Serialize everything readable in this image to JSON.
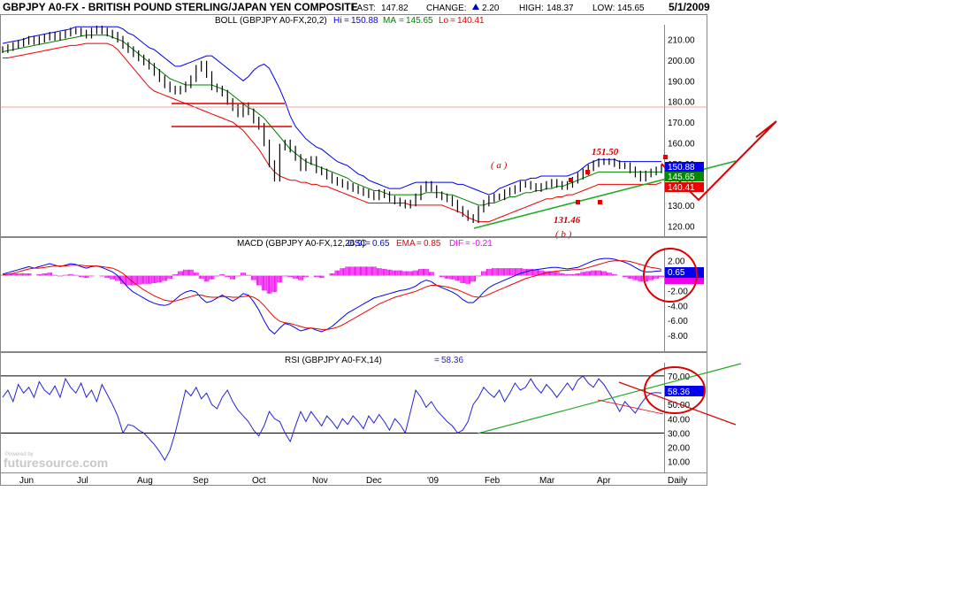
{
  "header": {
    "title": "GBPJPY A0-FX - BRITISH POUND STERLING/JAPAN YEN COMPOSITE",
    "last_label": "LAST:",
    "last": "147.82",
    "change_label": "CHANGE:",
    "change": "2.20",
    "high_label": "HIGH:",
    "high": "148.37",
    "low_label": "LOW:",
    "low": "145.65",
    "date": "5/1/2009"
  },
  "watermark": {
    "small": "Powered by",
    "brand": "futuresource.com"
  },
  "colors": {
    "price": "#000000",
    "upper_band": "#0000ee",
    "middle_band": "#008000",
    "lower_band": "#ee0000",
    "macd_line": "#0000ee",
    "signal_line": "#ee0000",
    "histogram": "#ee00ee",
    "rsi_line": "#2222dd",
    "annotation": "#cc0000",
    "trend_green": "#22aa22"
  },
  "chart_data": [
    {
      "type": "line",
      "name": "price-panel",
      "legend": {
        "study": "BOLL (GBPJPY A0-FX,20,2)",
        "hi_label": "Hi",
        "hi": "150.88",
        "ma_label": "MA",
        "ma": "145.65",
        "lo_label": "Lo",
        "lo": "140.41"
      },
      "ylim": [
        115,
        217
      ],
      "yticks": [
        "210.00",
        "200.00",
        "190.00",
        "180.00",
        "170.00",
        "160.00",
        "150.00",
        "140.00",
        "130.00",
        "120.00"
      ],
      "series": [
        {
          "name": "price",
          "values": [
            205,
            206,
            207,
            208,
            209,
            210,
            209,
            210,
            211,
            212,
            211,
            212,
            213,
            214,
            214,
            213,
            212,
            214,
            215,
            214,
            213,
            212,
            210,
            207,
            205,
            203,
            201,
            199,
            197,
            194,
            191,
            188,
            186,
            185,
            186,
            188,
            191,
            196,
            198,
            193,
            187,
            186,
            184,
            180,
            177,
            174,
            178,
            175,
            171,
            168,
            160,
            150,
            143,
            158,
            160,
            157,
            153,
            148,
            151,
            152,
            147,
            146,
            144,
            142,
            141,
            140,
            139,
            138,
            137,
            136,
            135,
            134,
            136,
            135,
            133,
            132,
            131,
            130,
            131,
            134,
            138,
            140,
            138,
            135,
            134,
            133,
            131,
            128,
            126,
            124,
            123,
            128,
            131,
            133,
            134,
            134,
            136,
            137,
            138,
            140,
            140,
            139,
            138,
            139,
            140,
            141,
            140,
            139,
            140,
            142,
            144,
            146,
            148,
            150,
            151,
            151,
            151,
            150,
            149,
            149,
            147,
            145,
            143,
            145,
            146,
            147,
            148
          ]
        },
        {
          "name": "upper_band",
          "values": [
            208,
            208.5,
            209,
            209.5,
            210,
            211,
            211.5,
            212,
            212.5,
            213,
            213.5,
            214,
            214.5,
            215,
            216,
            216,
            216,
            216,
            216,
            216,
            216,
            216,
            216,
            215,
            213,
            212,
            210,
            208,
            206,
            205,
            203,
            201,
            199,
            197,
            197,
            198,
            199,
            200,
            201,
            202,
            202,
            200,
            198,
            196,
            194,
            192,
            190,
            192,
            195,
            197,
            198,
            196,
            191,
            186,
            180,
            173,
            168,
            165,
            162,
            160,
            158,
            157,
            155,
            153,
            151,
            150,
            149,
            147,
            145,
            144,
            142,
            141,
            140,
            139,
            138,
            138,
            138,
            139,
            140,
            141,
            141,
            141,
            141,
            141,
            141,
            141,
            141,
            140,
            140,
            139,
            138,
            137,
            136,
            135,
            136,
            138,
            139,
            140,
            141,
            142,
            142,
            143,
            143,
            144,
            144,
            144,
            144,
            144,
            144,
            145,
            146,
            148,
            150,
            151,
            152,
            152,
            152,
            152,
            151,
            151,
            151,
            151,
            151,
            151,
            151,
            151,
            151
          ]
        },
        {
          "name": "middle_band",
          "values": [
            204,
            204.5,
            205,
            205.5,
            206,
            206.5,
            207,
            207.5,
            208,
            208.5,
            209,
            209.5,
            210,
            210.5,
            211,
            211.5,
            212,
            212,
            212,
            212,
            212,
            211,
            210,
            209,
            207,
            205,
            203,
            201,
            199,
            197,
            195,
            193,
            191,
            190,
            189,
            188,
            188,
            188,
            188,
            188,
            188,
            187,
            186,
            185,
            183,
            181,
            179,
            177,
            176,
            174,
            172,
            169,
            166,
            163,
            160,
            157,
            155,
            153,
            151,
            150,
            149,
            148,
            147,
            146,
            145,
            144,
            143,
            141,
            140,
            139,
            138,
            137,
            137,
            136,
            135,
            135,
            135,
            135,
            135,
            135,
            135,
            136,
            136,
            136,
            136,
            135,
            135,
            134,
            133,
            132,
            131,
            130,
            130,
            131,
            131,
            132,
            133,
            134,
            134,
            135,
            136,
            136,
            137,
            137,
            138,
            138,
            139,
            139,
            140,
            141,
            142,
            143,
            144,
            145,
            146,
            146,
            146,
            146,
            146,
            146,
            146,
            146,
            146,
            146,
            146,
            146,
            146
          ]
        },
        {
          "name": "lower_band",
          "values": [
            201,
            201,
            201.5,
            202,
            202.5,
            203,
            203.5,
            204,
            204.5,
            205,
            205.5,
            206,
            206.5,
            207,
            207,
            207.5,
            208,
            208,
            208,
            208,
            208,
            207,
            205,
            202,
            199,
            196,
            193,
            190,
            187,
            185,
            184,
            183,
            182,
            181,
            180,
            179,
            178,
            177,
            176,
            175,
            174,
            173,
            172,
            171,
            170,
            168,
            166,
            163,
            160,
            157,
            153,
            149,
            146,
            144,
            143,
            142,
            142,
            141,
            141,
            140,
            140,
            139,
            139,
            138,
            137,
            136,
            135,
            134,
            133,
            132,
            131,
            131,
            131,
            131,
            131,
            131,
            131,
            131,
            130,
            130,
            130,
            130,
            130,
            130,
            130,
            129,
            128,
            127,
            126,
            124,
            123,
            122,
            122,
            122,
            123,
            124,
            125,
            126,
            127,
            128,
            129,
            130,
            131,
            132,
            133,
            133,
            134,
            134,
            135,
            135,
            136,
            137,
            138,
            139,
            140,
            140,
            140,
            140,
            140,
            140,
            140,
            140,
            140,
            140,
            140,
            140,
            141
          ]
        }
      ],
      "annotations": [
        {
          "text": "( a )"
        },
        {
          "text": "151.50"
        },
        {
          "text": "131.46"
        },
        {
          "text": "( b )"
        }
      ],
      "last_labels": [
        "150.88",
        "145.65",
        "140.41"
      ]
    },
    {
      "type": "bar",
      "name": "macd-panel",
      "legend": {
        "study": "MACD (GBPJPY A0-FX,12,26,9)",
        "osc_label": "OSC",
        "osc": "0.65",
        "ema_label": "EMA",
        "ema": "0.85",
        "dif_label": "DIF",
        "dif": "-0.21"
      },
      "ylim": [
        -10,
        3.5
      ],
      "yticks": [
        "2.00",
        "0.00",
        "-2.00",
        "-4.00",
        "-6.00",
        "-8.00"
      ],
      "series": [
        {
          "name": "macd",
          "values": [
            0.2,
            0.4,
            0.6,
            0.8,
            1.0,
            1.2,
            1.0,
            1.2,
            1.4,
            1.6,
            1.4,
            1.2,
            1.4,
            1.6,
            1.5,
            1.2,
            1.0,
            1.2,
            1.3,
            1.1,
            0.8,
            0.5,
            0.0,
            -0.8,
            -1.6,
            -2.2,
            -2.6,
            -3.0,
            -3.4,
            -3.7,
            -3.9,
            -4.0,
            -3.8,
            -3.2,
            -2.6,
            -2.2,
            -2.0,
            -2.2,
            -3.0,
            -3.6,
            -3.4,
            -3.0,
            -2.6,
            -3.0,
            -3.4,
            -3.0,
            -2.4,
            -2.6,
            -3.5,
            -4.6,
            -6.0,
            -7.2,
            -7.8,
            -7.0,
            -6.4,
            -6.6,
            -7.0,
            -7.4,
            -7.2,
            -7.0,
            -7.3,
            -7.5,
            -7.2,
            -6.8,
            -6.2,
            -5.6,
            -5.0,
            -4.6,
            -4.2,
            -3.8,
            -3.4,
            -3.0,
            -2.8,
            -2.6,
            -2.4,
            -2.2,
            -2.0,
            -1.9,
            -1.7,
            -1.4,
            -0.9,
            -0.6,
            -0.8,
            -1.3,
            -1.6,
            -1.9,
            -2.2,
            -2.6,
            -3.2,
            -3.6,
            -3.6,
            -3.0,
            -2.2,
            -1.6,
            -1.2,
            -0.9,
            -0.6,
            -0.3,
            0.0,
            0.3,
            0.5,
            0.7,
            0.8,
            0.9,
            1.0,
            1.1,
            1.1,
            1.0,
            0.9,
            1.0,
            1.1,
            1.4,
            1.7,
            2.0,
            2.2,
            2.3,
            2.3,
            2.2,
            2.0,
            1.8,
            1.5,
            1.1,
            0.7,
            0.5,
            0.5,
            0.6,
            0.65
          ]
        },
        {
          "name": "signal",
          "values": [
            0.1,
            0.2,
            0.3,
            0.5,
            0.7,
            0.9,
            1.0,
            1.0,
            1.1,
            1.2,
            1.3,
            1.3,
            1.3,
            1.4,
            1.4,
            1.4,
            1.3,
            1.3,
            1.3,
            1.2,
            1.1,
            1.0,
            0.7,
            0.3,
            -0.3,
            -0.9,
            -1.4,
            -1.9,
            -2.3,
            -2.7,
            -3.0,
            -3.3,
            -3.4,
            -3.4,
            -3.2,
            -3.0,
            -2.8,
            -2.6,
            -2.6,
            -2.8,
            -2.9,
            -2.9,
            -2.8,
            -2.8,
            -2.9,
            -2.9,
            -2.8,
            -2.7,
            -2.9,
            -3.3,
            -4.0,
            -4.8,
            -5.6,
            -6.1,
            -6.3,
            -6.4,
            -6.6,
            -6.8,
            -7.0,
            -7.0,
            -7.1,
            -7.2,
            -7.2,
            -7.1,
            -6.9,
            -6.6,
            -6.2,
            -5.8,
            -5.4,
            -5.0,
            -4.6,
            -4.2,
            -3.8,
            -3.5,
            -3.2,
            -2.9,
            -2.7,
            -2.5,
            -2.3,
            -2.1,
            -1.8,
            -1.5,
            -1.3,
            -1.3,
            -1.4,
            -1.5,
            -1.7,
            -1.9,
            -2.2,
            -2.5,
            -2.8,
            -2.9,
            -2.8,
            -2.5,
            -2.2,
            -1.9,
            -1.6,
            -1.3,
            -1.0,
            -0.7,
            -0.4,
            -0.2,
            0.0,
            0.2,
            0.4,
            0.5,
            0.6,
            0.7,
            0.7,
            0.8,
            0.8,
            0.9,
            1.1,
            1.3,
            1.5,
            1.7,
            1.9,
            2.0,
            2.0,
            2.0,
            1.9,
            1.7,
            1.5,
            1.3,
            1.1,
            1.0,
            0.85
          ]
        }
      ],
      "last_labels": [
        "0.65",
        "0.85"
      ]
    },
    {
      "type": "line",
      "name": "rsi-panel",
      "legend": {
        "study": "RSI (GBPJPY A0-FX,14)",
        "value": "58.36"
      },
      "ylim": [
        3,
        78
      ],
      "yticks": [
        "70.00",
        "60.00",
        "50.00",
        "40.00",
        "30.00",
        "20.00",
        "10.00"
      ],
      "hlines": [
        70,
        30
      ],
      "series": [
        {
          "name": "rsi",
          "values": [
            55,
            60,
            52,
            64,
            58,
            62,
            55,
            66,
            60,
            57,
            63,
            55,
            68,
            62,
            58,
            65,
            55,
            60,
            52,
            64,
            57,
            50,
            42,
            30,
            36,
            35,
            32,
            30,
            26,
            22,
            17,
            11,
            18,
            30,
            45,
            60,
            56,
            62,
            54,
            58,
            50,
            47,
            55,
            60,
            52,
            46,
            42,
            38,
            32,
            28,
            35,
            45,
            40,
            38,
            30,
            24,
            35,
            45,
            38,
            45,
            40,
            35,
            42,
            38,
            33,
            40,
            36,
            42,
            38,
            33,
            42,
            37,
            43,
            38,
            32,
            40,
            36,
            30,
            45,
            60,
            55,
            48,
            52,
            46,
            42,
            38,
            35,
            30,
            32,
            38,
            50,
            55,
            62,
            58,
            55,
            60,
            52,
            58,
            65,
            60,
            62,
            68,
            62,
            58,
            64,
            60,
            55,
            60,
            65,
            60,
            67,
            70,
            65,
            62,
            68,
            64,
            58,
            52,
            45,
            52,
            48,
            44,
            50,
            55,
            58,
            58.36,
            58
          ]
        }
      ],
      "last_label": "58.36"
    }
  ],
  "x_axis": {
    "ticks": [
      "Jun",
      "Jul",
      "Aug",
      "Sep",
      "Oct",
      "Nov",
      "Dec",
      "'09",
      "Feb",
      "Mar",
      "Apr",
      "Daily"
    ]
  }
}
